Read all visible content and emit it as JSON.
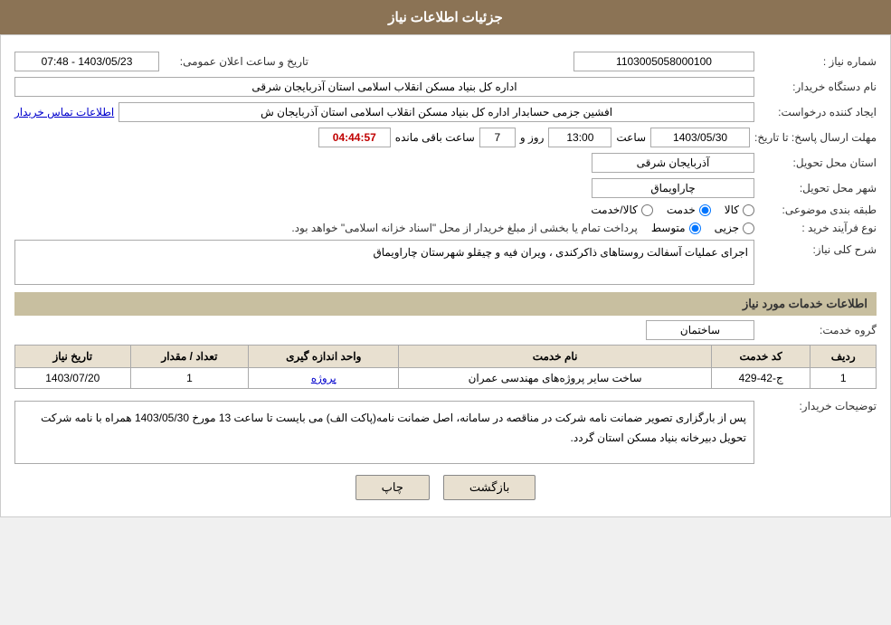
{
  "header": {
    "title": "جزئیات اطلاعات نیاز"
  },
  "fields": {
    "shomare_niaz_label": "شماره نیاز :",
    "shomare_niaz_value": "1103005058000100",
    "nam_dastgah_label": "نام دستگاه خریدار:",
    "nam_dastgah_value": "اداره کل بنیاد مسکن انقلاب اسلامی استان آذربایجان شرقی",
    "ijad_konande_label": "ایجاد کننده درخواست:",
    "ijad_konande_value": "افشین جزمی حسابدار اداره کل بنیاد مسکن انقلاب اسلامی استان آذربایجان ش",
    "ijad_konande_link": "اطلاعات تماس خریدار",
    "mohlat_label": "مهلت ارسال پاسخ: تا تاریخ:",
    "mohlat_date": "1403/05/30",
    "mohlat_saat_label": "ساعت",
    "mohlat_saat": "13:00",
    "mohlat_roz_label": "روز و",
    "mohlat_roz": "7",
    "mohlat_baghimande_label": "ساعت باقی مانده",
    "mohlat_baghimande": "04:44:57",
    "ostan_label": "استان محل تحویل:",
    "ostan_value": "آذربایجان شرقی",
    "shahr_label": "شهر محل تحویل:",
    "shahr_value": "چاراویماق",
    "tabaqe_label": "طبقه بندی موضوعی:",
    "tabaqe_options": [
      {
        "label": "کالا",
        "value": "kala"
      },
      {
        "label": "خدمت",
        "value": "khedmat"
      },
      {
        "label": "کالا/خدمت",
        "value": "kala_khedmat"
      }
    ],
    "tabaqe_selected": "khedmat",
    "noavand_label": "نوع فرآیند خرید :",
    "noavand_options": [
      {
        "label": "جزیی",
        "value": "jozii"
      },
      {
        "label": "متوسط",
        "value": "motovaset"
      }
    ],
    "noavand_selected": "motovaset",
    "noavand_desc": "پرداخت تمام یا بخشی از مبلغ خریدار از محل \"اسناد خزانه اسلامی\" خواهد بود.",
    "sharh_label": "شرح کلی نیاز:",
    "sharh_value": "اجرای عملیات آسفالت روستاهای ذاکرکندی ، ویران فیه و چیقلو شهرستان چاراویماق",
    "service_section_title": "اطلاعات خدمات مورد نیاز",
    "group_service_label": "گروه خدمت:",
    "group_service_value": "ساختمان",
    "tarix_announced": "تاریخ و ساعت اعلان عمومی:",
    "tarix_announced_value": "1403/05/23 - 07:48",
    "table": {
      "headers": [
        "ردیف",
        "کد خدمت",
        "نام خدمت",
        "واحد اندازه گیری",
        "تعداد / مقدار",
        "تاریخ نیاز"
      ],
      "rows": [
        {
          "radif": "1",
          "kod": "ج-42-429",
          "nam": "ساخت سایر پروژه‌های مهندسی عمران",
          "vahed": "پروژه",
          "tedad": "1",
          "tarix": "1403/07/20"
        }
      ]
    },
    "tawzihat_label": "توضیحات خریدار:",
    "tawzihat_value": "پس از بارگزاری تصویر ضمانت نامه شرکت در مناقصه در سامانه، اصل ضمانت نامه(پاکت الف) می بایست تا ساعت 13 مورخ 1403/05/30 همراه با نامه شرکت تحویل دبیرخانه بنیاد مسکن استان گردد."
  },
  "buttons": {
    "bazgasht": "بازگشت",
    "chap": "چاپ"
  }
}
